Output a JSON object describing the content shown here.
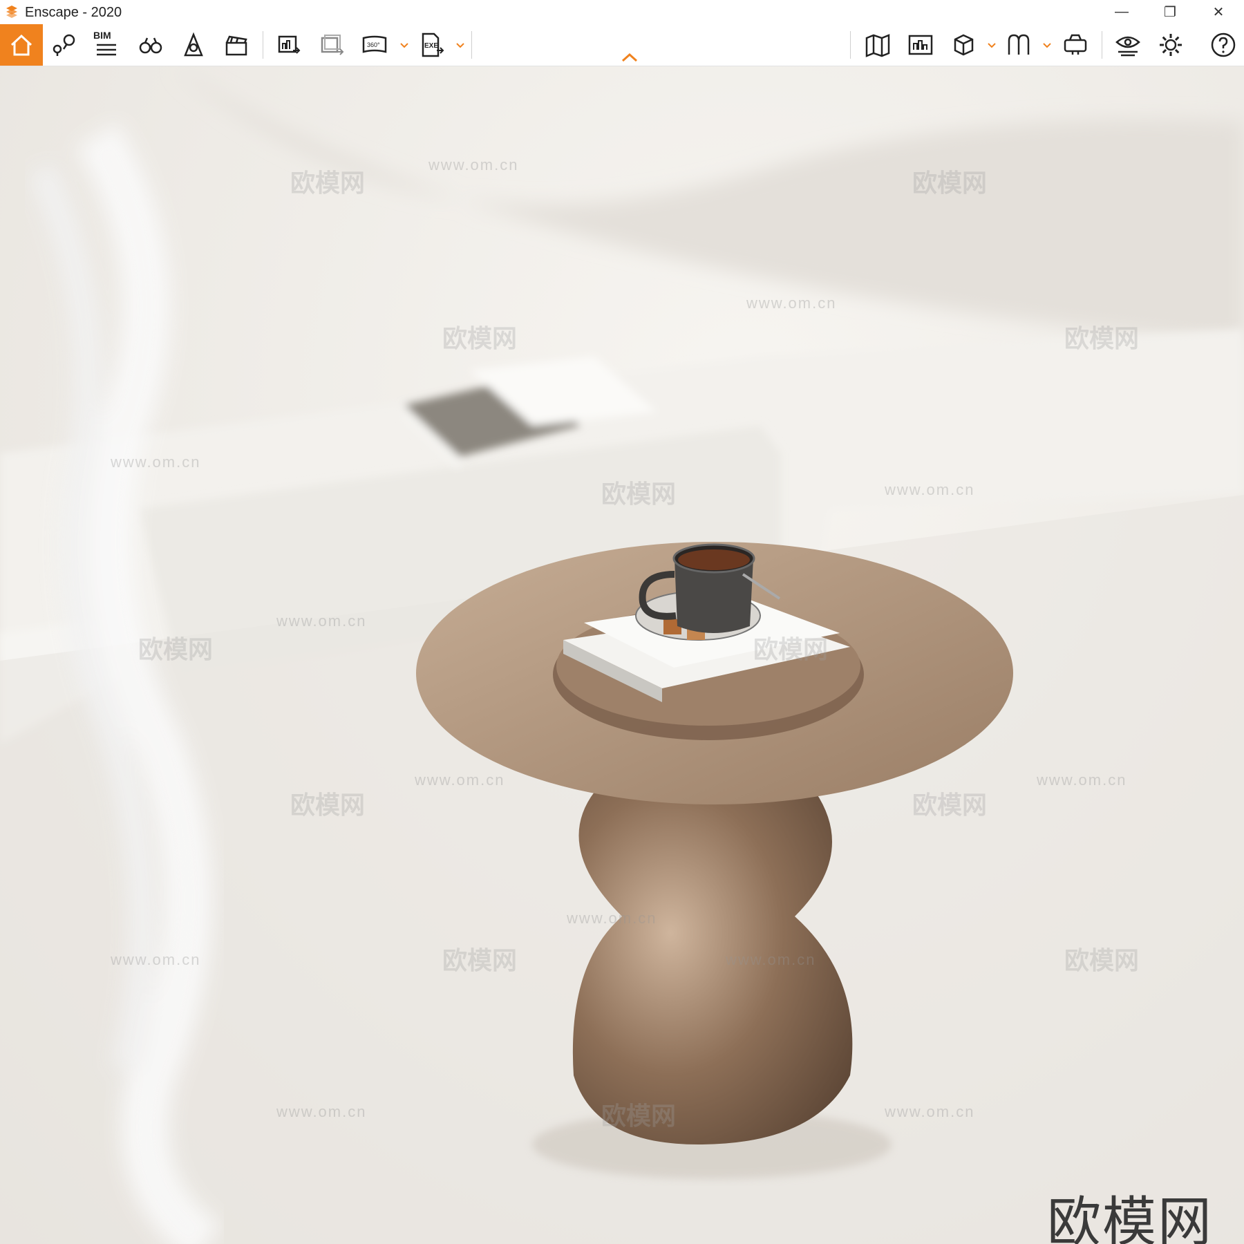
{
  "window": {
    "title": "Enscape - 2020",
    "minimize_glyph": "—",
    "restore_glyph": "❐",
    "close_glyph": "✕"
  },
  "toolbar": {
    "bim_label": "BIM",
    "screenshot_360_label": "360°",
    "exe_label": "EXE",
    "accent_color": "#f0821e",
    "icons": [
      "home-icon",
      "location-pins-icon",
      "bim-list-icon",
      "binoculars-icon",
      "sun-tower-icon",
      "clapper-icon",
      "batch-render-icon",
      "batch-export-icon",
      "panorama-360-icon",
      "exe-export-icon",
      "map-icon",
      "render-view-icon",
      "cube-icon",
      "asset-icon",
      "vr-headset-icon",
      "visual-settings-icon",
      "gear-icon",
      "help-icon"
    ]
  },
  "viewport": {
    "watermark_url": "www.om.cn",
    "watermark_cn": "欧模网",
    "brand_mark": "欧模网",
    "colors": {
      "table_bronze": "#9c7f66",
      "table_top": "#b59a82",
      "background": "#eeebe6"
    }
  }
}
